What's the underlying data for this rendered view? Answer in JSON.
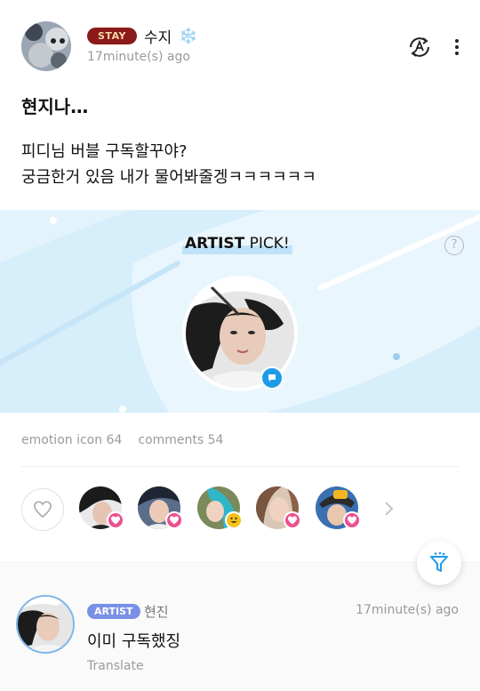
{
  "post": {
    "author_badge": "STAY",
    "author_name": "수지",
    "author_emoji": "❄️",
    "time": "17minute(s) ago",
    "title": "현지나…",
    "body_line1": "피디님 버블 구독할꾸야?",
    "body_line2": "궁금한거 있음 내가 물어봐줄겡ㅋㅋㅋㅋㅋㅋ"
  },
  "artist_pick": {
    "label_bold": "ARTIST",
    "label_rest": " PICK!",
    "help_symbol": "?"
  },
  "stats": {
    "emotion": "emotion icon 64",
    "comments": "comments 54"
  },
  "reactors": [
    {
      "emotion": "heart-icon"
    },
    {
      "emotion": "heart-icon"
    },
    {
      "emotion": "smile-icon"
    },
    {
      "emotion": "heart-icon"
    },
    {
      "emotion": "heart-icon"
    }
  ],
  "comment": {
    "badge": "ARTIST",
    "name": "현진",
    "time": "17minute(s) ago",
    "text": "이미 구독했징",
    "translate": "Translate"
  },
  "colors": {
    "stay_badge": "#8b1a1a",
    "artist_badge": "#7a90e6",
    "pick_background": "#e3f3fc",
    "accent_blue": "#1e9be6",
    "heart_pink": "#ec4f8f"
  }
}
